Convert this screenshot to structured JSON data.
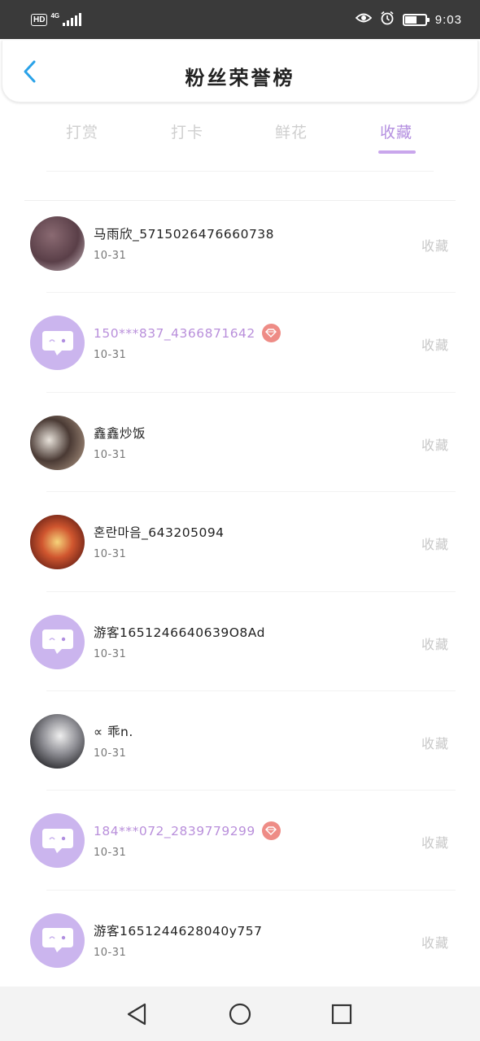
{
  "status_bar": {
    "hd_label": "HD",
    "network": "4G",
    "time": "9:03",
    "battery_level": 0.6,
    "icons": [
      "eye-comfort-icon",
      "alarm-icon",
      "battery-icon",
      "signal-icon"
    ]
  },
  "header": {
    "title": "粉丝荣誉榜",
    "back_icon": "chevron-left-icon",
    "accent_color": "#2aa2e8"
  },
  "tabs": [
    {
      "label": "打赏",
      "active": false
    },
    {
      "label": "打卡",
      "active": false
    },
    {
      "label": "鲜花",
      "active": false
    },
    {
      "label": "收藏",
      "active": true
    }
  ],
  "colors": {
    "active_tab": "#b48fe0",
    "vip_name": "#b98fdb",
    "default_avatar": "#cbb5ee",
    "vip_badge": "#ee8c86"
  },
  "list": [
    {
      "name": "马雨欣_5715026476660738",
      "date": "10-31",
      "action": "收藏",
      "vip": false,
      "avatar": "photo"
    },
    {
      "name": "150***837_4366871642",
      "date": "10-31",
      "action": "收藏",
      "vip": true,
      "avatar": "default-chat"
    },
    {
      "name": "鑫鑫炒饭",
      "date": "10-31",
      "action": "收藏",
      "vip": false,
      "avatar": "photo"
    },
    {
      "name": "혼란마음_643205094",
      "date": "10-31",
      "action": "收藏",
      "vip": false,
      "avatar": "photo"
    },
    {
      "name": "游客1651246640639O8Ad",
      "date": "10-31",
      "action": "收藏",
      "vip": false,
      "avatar": "default-chat"
    },
    {
      "name": "∝ 乖n.",
      "date": "10-31",
      "action": "收藏",
      "vip": false,
      "avatar": "photo"
    },
    {
      "name": "184***072_2839779299",
      "date": "10-31",
      "action": "收藏",
      "vip": true,
      "avatar": "default-chat"
    },
    {
      "name": "游客1651244628040y757",
      "date": "10-31",
      "action": "收藏",
      "vip": false,
      "avatar": "default-chat"
    }
  ],
  "nav": [
    "back-triangle-icon",
    "home-circle-icon",
    "recents-square-icon"
  ]
}
